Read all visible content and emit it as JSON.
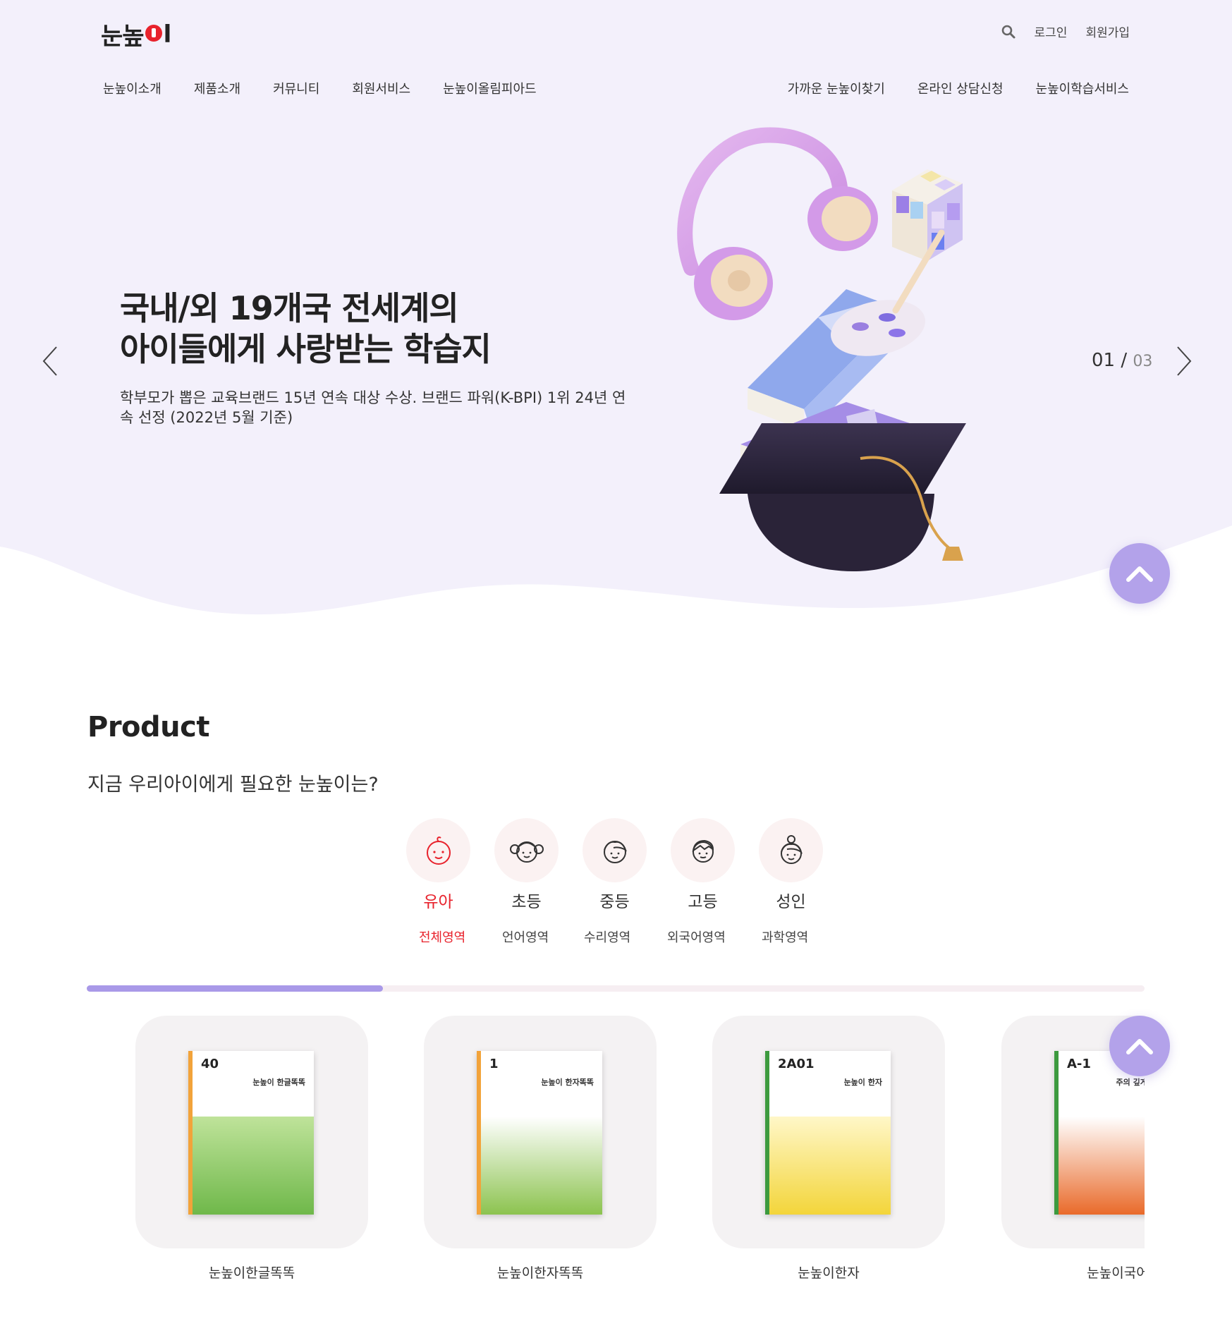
{
  "header": {
    "logo": "눈높이",
    "util": {
      "login": "로그인",
      "join": "회원가입"
    },
    "gnb_left": [
      "눈높이소개",
      "제품소개",
      "커뮤니티",
      "회원서비스",
      "눈높이올림피아드"
    ],
    "gnb_right": [
      "가까운 눈높이찾기",
      "온라인 상담신청",
      "눈높이학습서비스"
    ]
  },
  "hero": {
    "title_line1": "국내/외 19개국 전세계의",
    "title_line2": "아이들에게 사랑받는 학습지",
    "desc": "학부모가 뽑은 교육브랜드 15년 연속 대상 수상. 브랜드 파워(K-BPI) 1위 24년 연속 선정 (2022년 5월 기준)",
    "pager_current": "01",
    "pager_sep": "/",
    "pager_total": "03"
  },
  "product": {
    "title": "Product",
    "subtitle": "지금 우리아이에게 필요한 눈높이는?",
    "ages": [
      {
        "label": "유아",
        "icon": "baby-icon",
        "active": true
      },
      {
        "label": "초등",
        "icon": "girl-icon",
        "active": false
      },
      {
        "label": "중등",
        "icon": "child-icon",
        "active": false
      },
      {
        "label": "고등",
        "icon": "teen-icon",
        "active": false
      },
      {
        "label": "성인",
        "icon": "adult-icon",
        "active": false
      }
    ],
    "areas": [
      "전체영역",
      "언어영역",
      "수리영역",
      "외국어영역",
      "과학영역"
    ],
    "active_area": "전체영역",
    "progress": 0.28,
    "items": [
      {
        "name": "눈높이한글똑똑",
        "cover_num": "40",
        "cover_brand": "눈높이 한글똑똑"
      },
      {
        "name": "눈높이한자똑똑",
        "cover_num": "1",
        "cover_brand": "눈높이 한자똑똑"
      },
      {
        "name": "눈높이한자",
        "cover_num": "2A01",
        "cover_brand": "눈높이 한자"
      },
      {
        "name": "눈높이국어",
        "cover_num": "A-1",
        "cover_brand": "주의 깊게 들어요"
      }
    ]
  },
  "colors": {
    "accent_red": "#e8222c",
    "hero_bg": "#f3f0fb",
    "purple": "#b3a2ea",
    "progress_fill": "#a999e8"
  }
}
